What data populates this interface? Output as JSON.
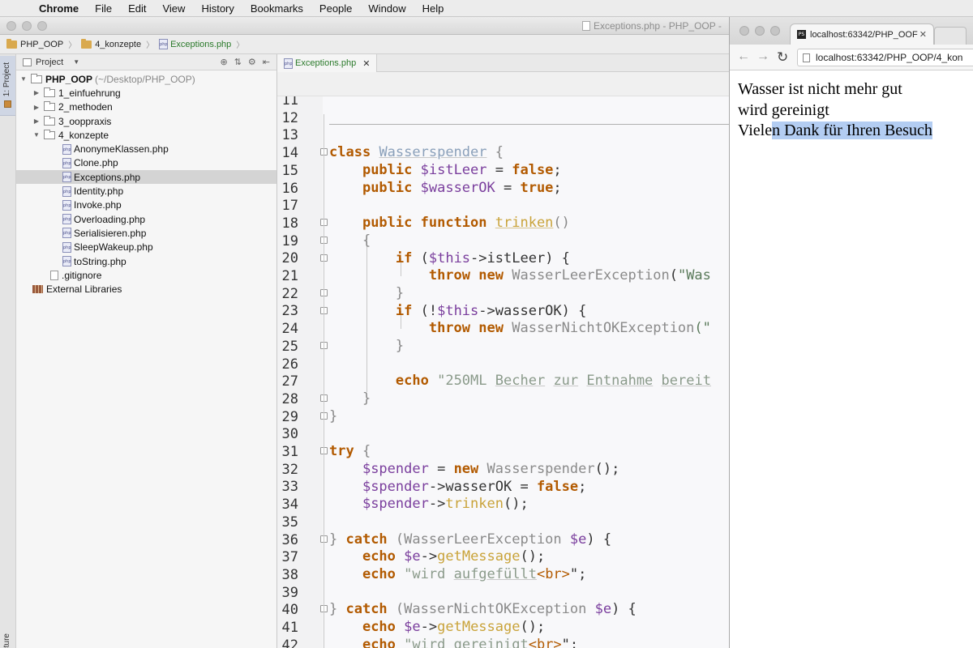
{
  "menubar": {
    "app": "Chrome",
    "items": [
      "File",
      "Edit",
      "View",
      "History",
      "Bookmarks",
      "People",
      "Window",
      "Help"
    ]
  },
  "ide": {
    "window_title": "Exceptions.php - PHP_OOP -",
    "breadcrumb": [
      "PHP_OOP",
      "4_konzepte",
      "Exceptions.php"
    ],
    "panel": {
      "view_label": "Project",
      "side_tab": "1: Project",
      "side_tab_bottom": "Structure"
    },
    "tree": {
      "root_name": "PHP_OOP",
      "root_path": "(~/Desktop/PHP_OOP)",
      "folders": [
        "1_einfuehrung",
        "2_methoden",
        "3_ooppraxis",
        "4_konzepte"
      ],
      "files": [
        "AnonymeKlassen.php",
        "Clone.php",
        "Exceptions.php",
        "Identity.php",
        "Invoke.php",
        "Overloading.php",
        "Serialisieren.php",
        "SleepWakeup.php",
        "toString.php"
      ],
      "gitignore": ".gitignore",
      "external": "External Libraries"
    },
    "editor_tab": "Exceptions.php",
    "line_numbers": [
      "11",
      "12",
      "13",
      "14",
      "15",
      "16",
      "17",
      "18",
      "19",
      "20",
      "21",
      "22",
      "23",
      "24",
      "25",
      "26",
      "27",
      "28",
      "29",
      "30",
      "31",
      "32",
      "33",
      "34",
      "35",
      "36",
      "37",
      "38",
      "39",
      "40",
      "41",
      "42"
    ],
    "code": {
      "l13": {
        "kw": "class",
        "cls": "Wasserspender",
        "rest": " {"
      },
      "l14": {
        "kw": "public",
        "var": "$istLeer",
        "eq": " = ",
        "val": "false",
        "end": ";"
      },
      "l15": {
        "kw": "public",
        "var": "$wasserOK",
        "eq": " = ",
        "val": "true",
        "end": ";"
      },
      "l17": {
        "kw1": "public",
        "kw2": "function",
        "fn": "trinken",
        "end": "()"
      },
      "l18": "{",
      "l19": {
        "kw": "if",
        "open": " (",
        "var": "$this",
        "arrow": "->",
        "prop": "istLeer",
        "end": ") {"
      },
      "l20": {
        "kw1": "throw",
        "kw2": "new",
        "cls": "WasserLeerException",
        "open": "(",
        "str": "\"Was"
      },
      "l21": "}",
      "l22": {
        "kw": "if",
        "open": " (!",
        "var": "$this",
        "arrow": "->",
        "prop": "wasserOK",
        "end": ") {"
      },
      "l23": {
        "kw1": "throw",
        "kw2": "new",
        "cls": "WasserNichtOKException",
        "end": "(\""
      },
      "l24": "}",
      "l26": {
        "kw": "echo",
        "q": " \"",
        "s1": "250ML",
        "s2": "Becher",
        "s3": "zur",
        "s4": "Entnahme",
        "s5": "bereit"
      },
      "l27": "}",
      "l28": "}",
      "l30": {
        "kw": "try",
        "rest": " {"
      },
      "l31": {
        "var": "$spender",
        "eq": " = ",
        "kw": "new",
        "cls": "Wasserspender",
        "end": "();"
      },
      "l32": {
        "var": "$spender",
        "arrow": "->",
        "prop": "wasserOK",
        "eq": " = ",
        "val": "false",
        "end": ";"
      },
      "l33": {
        "var": "$spender",
        "arrow": "->",
        "call": "trinken",
        "end": "();"
      },
      "l35": {
        "open": "} ",
        "kw": "catch",
        "p1": " (",
        "cls": "WasserLeerException",
        "var": "$e",
        "end": ") {"
      },
      "l36": {
        "kw": "echo",
        "var": "$e",
        "arrow": "->",
        "call": "getMessage",
        "end": "();"
      },
      "l37": {
        "kw": "echo",
        "q": " \"",
        "s1": "wird",
        "s2": "aufgefüllt",
        "tag": "<br>",
        "end": "\";"
      },
      "l39": {
        "open": "} ",
        "kw": "catch",
        "p1": " (",
        "cls": "WasserNichtOKException",
        "var": "$e",
        "end": ") {"
      },
      "l40": {
        "kw": "echo",
        "var": "$e",
        "arrow": "->",
        "call": "getMessage",
        "end": "();"
      },
      "l41": {
        "kw": "echo",
        "q": " \"",
        "s1": "wird",
        "s2": "gereinigt",
        "tag": "<br>",
        "end": "\";"
      }
    }
  },
  "browser": {
    "tab_title": "localhost:63342/PHP_OOF",
    "tab_icon": "PS",
    "url": "localhost:63342/PHP_OOP/4_kon",
    "output": {
      "line1": "Wasser ist nicht mehr gut",
      "line2": "wird gereinigt",
      "line3_a": "Viele",
      "line3_b": "n Dank für Ihren Besuch"
    }
  },
  "colors": {
    "keyword": "#b25a00",
    "variable": "#7a3e9d",
    "function": "#c9a33a",
    "selection": "#b3cdf2"
  }
}
